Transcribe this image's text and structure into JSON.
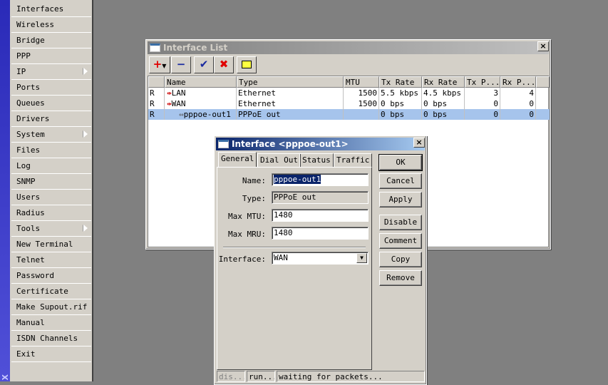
{
  "app": {
    "strip_label": "X"
  },
  "menu": [
    {
      "label": "Interfaces"
    },
    {
      "label": "Wireless"
    },
    {
      "label": "Bridge"
    },
    {
      "label": "PPP"
    },
    {
      "label": "IP",
      "submenu": true
    },
    {
      "label": "Ports"
    },
    {
      "label": "Queues"
    },
    {
      "label": "Drivers"
    },
    {
      "label": "System",
      "submenu": true
    },
    {
      "label": "Files"
    },
    {
      "label": "Log"
    },
    {
      "label": "SNMP"
    },
    {
      "label": "Users"
    },
    {
      "label": "Radius"
    },
    {
      "label": "Tools",
      "submenu": true
    },
    {
      "label": "New Terminal"
    },
    {
      "label": "Telnet"
    },
    {
      "label": "Password"
    },
    {
      "label": "Certificate"
    },
    {
      "label": "Make Supout.rif"
    },
    {
      "label": "Manual"
    },
    {
      "label": "ISDN Channels"
    },
    {
      "label": "Exit"
    }
  ],
  "iflist": {
    "title": "Interface List",
    "close": "×",
    "toolbar": {
      "add": "+",
      "remove": "−",
      "enable": "✔",
      "disable": "✖",
      "comment": "▭"
    },
    "columns": [
      "",
      "Name",
      "Type",
      "MTU",
      "Tx Rate",
      "Rx Rate",
      "Tx P...",
      "Rx P..."
    ],
    "rows": [
      {
        "flag": "R",
        "name": "LAN",
        "type": "Ethernet",
        "mtu": "1500",
        "tx": "5.5 kbps",
        "rx": "4.5 kbps",
        "txp": "3",
        "rxp": "4"
      },
      {
        "flag": "R",
        "name": "WAN",
        "type": "Ethernet",
        "mtu": "1500",
        "tx": "0 bps",
        "rx": "0 bps",
        "txp": "0",
        "rxp": "0"
      },
      {
        "flag": "R",
        "name": "pppoe-out1",
        "type": "PPPoE out",
        "mtu": "",
        "tx": "0 bps",
        "rx": "0 bps",
        "txp": "0",
        "rxp": "0",
        "selected": true
      }
    ]
  },
  "dialog": {
    "title": "Interface <pppoe-out1>",
    "close": "×",
    "tabs": [
      "General",
      "Dial Out",
      "Status",
      "Traffic"
    ],
    "active_tab": "General",
    "fields": {
      "name_label": "Name:",
      "name_value": "pppoe-out1",
      "type_label": "Type:",
      "type_value": "PPPoE out",
      "mtu_label": "Max MTU:",
      "mtu_value": "1480",
      "mru_label": "Max MRU:",
      "mru_value": "1480",
      "iface_label": "Interface:",
      "iface_value": "WAN"
    },
    "buttons": [
      "OK",
      "Cancel",
      "Apply",
      "Disable",
      "Comment",
      "Copy",
      "Remove"
    ],
    "status": [
      "dis...",
      "run...",
      "waiting for packets..."
    ]
  }
}
